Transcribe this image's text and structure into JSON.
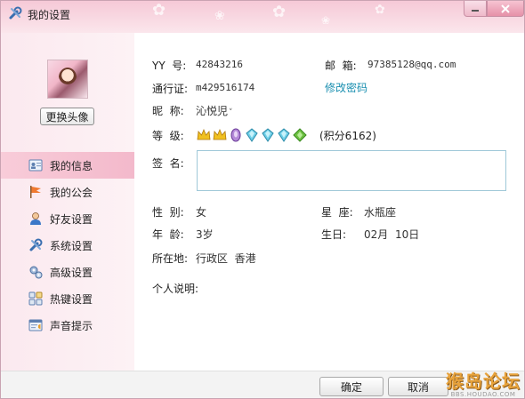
{
  "window": {
    "title": "我的设置"
  },
  "sidebar": {
    "change_avatar_label": "更换头像",
    "items": [
      {
        "label": "我的信息",
        "icon": "id-card-icon",
        "active": true
      },
      {
        "label": "我的公会",
        "icon": "flag-icon",
        "active": false
      },
      {
        "label": "好友设置",
        "icon": "person-icon",
        "active": false
      },
      {
        "label": "系统设置",
        "icon": "wrench-icon",
        "active": false
      },
      {
        "label": "高级设置",
        "icon": "gears-icon",
        "active": false
      },
      {
        "label": "热键设置",
        "icon": "keyboard-icon",
        "active": false
      },
      {
        "label": "声音提示",
        "icon": "sound-window-icon",
        "active": false
      }
    ]
  },
  "profile": {
    "yy_label": "YY  号:",
    "yy_value": "42843216",
    "email_label": "邮  箱:",
    "email_value": "97385128@qq.com",
    "passport_label": "通行证:",
    "passport_value": "m429516174",
    "change_password_link": "修改密码",
    "nickname_label": "昵  称:",
    "nickname_value": "沁悦児",
    "level_label": "等  级:",
    "level_icons": [
      "crown-icon",
      "crown-icon",
      "purple-gem-icon",
      "diamond-icon",
      "diamond-icon",
      "diamond-icon",
      "green-arrow-icon"
    ],
    "points_text": "(积分6162)",
    "signature_label": "签  名:",
    "signature_value": "",
    "gender_label": "性  别:",
    "gender_value": "女",
    "constellation_label": "星  座:",
    "constellation_value": "水瓶座",
    "age_label": "年  龄:",
    "age_value": "3岁",
    "birthday_label": "生日:",
    "birthday_month": "02月",
    "birthday_day": "10日",
    "location_label": "所在地:",
    "location_value": "行政区  香港",
    "personal_note_label": "个人说明:"
  },
  "footer": {
    "ok_label": "确定",
    "cancel_label": "取消",
    "watermark_big": "猴岛论坛",
    "watermark_small": "BBS.HOUDAO.COM"
  },
  "colors": {
    "title_pink": "#f6c9d7",
    "sidebar_pink": "#fbe9ef",
    "active_item": "#f3b9cb",
    "link_blue": "#1a8fb0"
  }
}
